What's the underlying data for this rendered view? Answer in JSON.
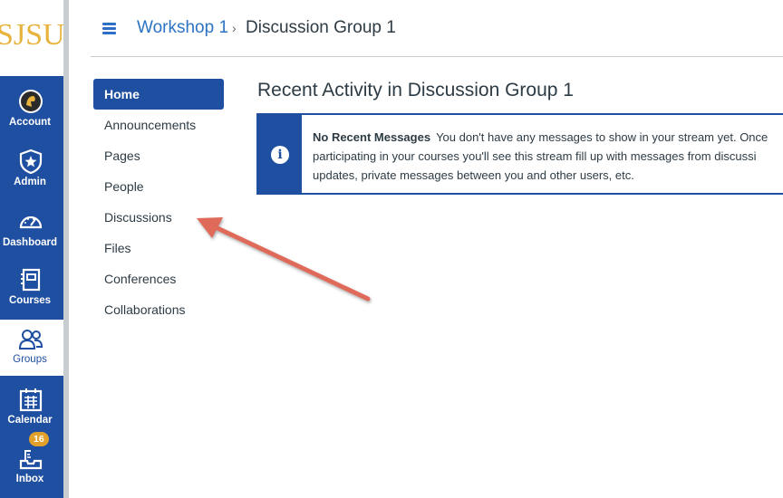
{
  "logo": "SJSU",
  "global_nav": [
    {
      "label": "Account",
      "icon": "account-avatar-icon"
    },
    {
      "label": "Admin",
      "icon": "shield-star-icon"
    },
    {
      "label": "Dashboard",
      "icon": "gauge-icon"
    },
    {
      "label": "Courses",
      "icon": "notebook-icon"
    },
    {
      "label": "Groups",
      "icon": "people-icon",
      "active": true
    },
    {
      "label": "Calendar",
      "icon": "calendar-icon"
    },
    {
      "label": "Inbox",
      "icon": "inbox-icon",
      "badge": "16"
    }
  ],
  "breadcrumb": {
    "parent": "Workshop 1",
    "separator": "›",
    "current": "Discussion Group 1"
  },
  "course_nav": [
    {
      "label": "Home",
      "active": true
    },
    {
      "label": "Announcements"
    },
    {
      "label": "Pages"
    },
    {
      "label": "People"
    },
    {
      "label": "Discussions"
    },
    {
      "label": "Files"
    },
    {
      "label": "Conferences"
    },
    {
      "label": "Collaborations"
    }
  ],
  "main": {
    "title": "Recent Activity in Discussion Group 1",
    "alert": {
      "heading": "No Recent Messages",
      "line1": "You don't have any messages to show in your stream yet. Once",
      "line2": "participating in your courses you'll see this stream fill up with messages from discussi",
      "line3": "updates, private messages between you and other users, etc."
    }
  },
  "colors": {
    "brand": "#1f4fa0",
    "accent_gold": "#e8b33d",
    "link": "#2d73c3",
    "annotation_arrow": "#e06b5a"
  }
}
